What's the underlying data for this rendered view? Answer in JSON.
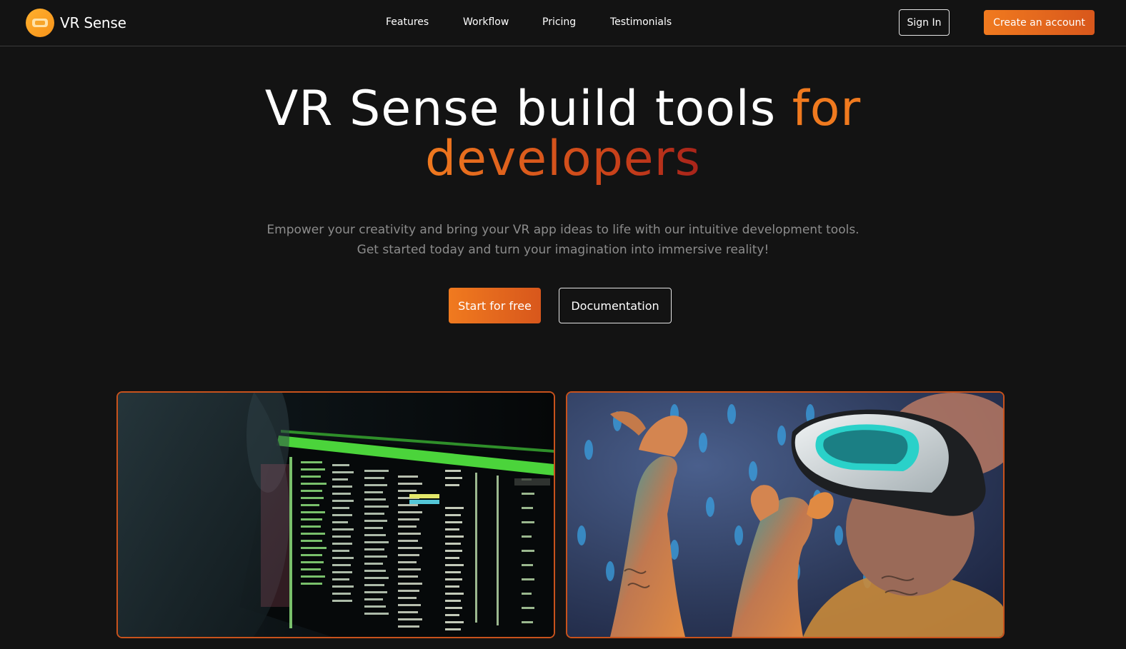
{
  "brand": {
    "name": "VR Sense"
  },
  "nav": {
    "links": [
      "Features",
      "Workflow",
      "Pricing",
      "Testimonials"
    ],
    "sign_in": "Sign In",
    "create_account": "Create an account"
  },
  "hero": {
    "title_main": "VR Sense build tools ",
    "title_accent_for": "for",
    "title_accent_dev": "developers",
    "subtitle_line1": "Empower your creativity and bring your VR app ideas to life with our intuitive development tools.",
    "subtitle_line2": "Get started today and turn your imagination into immersive reality!",
    "cta_primary": "Start for free",
    "cta_secondary": "Documentation"
  },
  "colors": {
    "accent": "#f07a1f",
    "accent_dark": "#c8401a",
    "background": "#131313"
  },
  "icons": {
    "logo": "vr-headset-icon"
  }
}
